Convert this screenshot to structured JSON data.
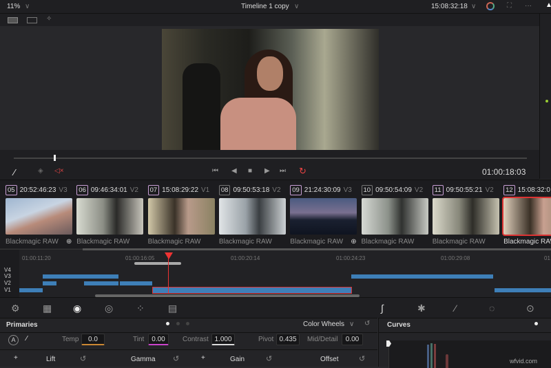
{
  "topbar": {
    "zoom": "11%",
    "title": "Timeline 1 copy",
    "timecode": "15:08:32:18",
    "chevron": "∨",
    "more": "···"
  },
  "viewer": {
    "timecode": "01:00:18:03",
    "transport": [
      "⏮",
      "◀",
      "■",
      "▶",
      "⏭"
    ]
  },
  "clips": [
    {
      "num": "05",
      "tc": "20:52:46:23",
      "track": "V3",
      "codec": "Blackmagic RAW",
      "color": "#c9a0d6"
    },
    {
      "num": "06",
      "tc": "09:46:34:01",
      "track": "V2",
      "codec": "Blackmagic RAW",
      "color": "#c9a0d6"
    },
    {
      "num": "07",
      "tc": "15:08:29:22",
      "track": "V1",
      "codec": "Blackmagic RAW",
      "color": "#c9a0d6"
    },
    {
      "num": "08",
      "tc": "09:50:53:18",
      "track": "V2",
      "codec": "Blackmagic RAW",
      "color": "#777"
    },
    {
      "num": "09",
      "tc": "21:24:30:09",
      "track": "V3",
      "codec": "Blackmagic RAW",
      "color": "#c9a0d6"
    },
    {
      "num": "10",
      "tc": "09:50:54:09",
      "track": "V2",
      "codec": "Blackmagic RAW",
      "color": "#777"
    },
    {
      "num": "11",
      "tc": "09:50:55:21",
      "track": "V2",
      "codec": "Blackmagic RAW",
      "color": "#c9a0d6"
    },
    {
      "num": "12",
      "tc": "15:08:32:0",
      "track": "",
      "codec": "Blackmagic RAW",
      "color": "#c9a0d6"
    }
  ],
  "timeline": {
    "ruler": [
      "01:00:11:20",
      "01:00:16:05",
      "01:00:20:14",
      "01:00:24:23",
      "01:00:29:08",
      "01"
    ],
    "tracks": [
      "V4",
      "V3",
      "V2",
      "V1"
    ]
  },
  "primaries": {
    "title": "Primaries",
    "mode": "Color Wheels",
    "temp_label": "Temp",
    "temp": "0.0",
    "tint_label": "Tint",
    "tint": "0.00",
    "contrast_label": "Contrast",
    "contrast": "1.000",
    "pivot_label": "Pivot",
    "pivot": "0.435",
    "md_label": "Mid/Detail",
    "md": "0.00",
    "auto": "A",
    "wheels": [
      "Lift",
      "Gamma",
      "Gain",
      "Offset"
    ]
  },
  "curves": {
    "title": "Curves"
  },
  "watermark": "wfvid.com"
}
